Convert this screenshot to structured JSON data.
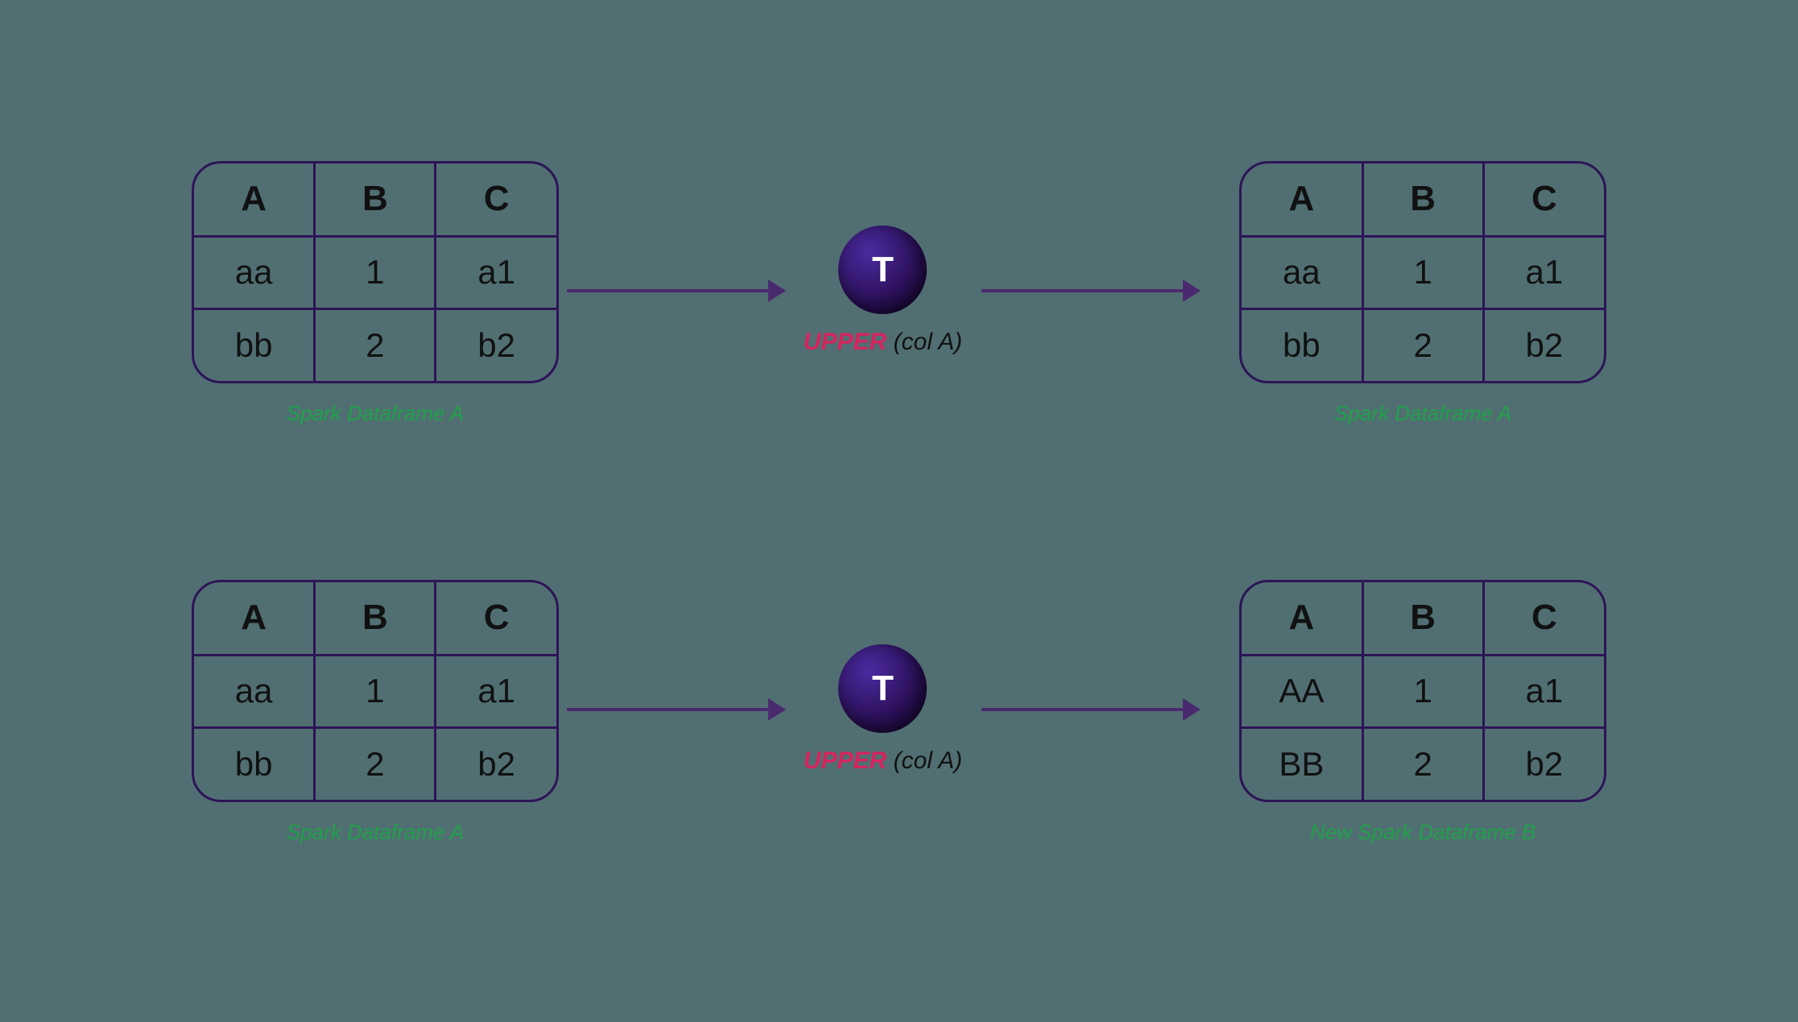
{
  "diagram": {
    "rows": [
      {
        "left_table": {
          "headers": [
            "A",
            "B",
            "C"
          ],
          "rows": [
            [
              "aa",
              "1",
              "a1"
            ],
            [
              "bb",
              "2",
              "b2"
            ]
          ],
          "caption": "Spark Dataframe A",
          "highlight_col_a": false
        },
        "transform": {
          "badge": "T",
          "label_hot": "UPPER",
          "label_rest": " (col A)"
        },
        "right_table": {
          "headers": [
            "A",
            "B",
            "C"
          ],
          "rows": [
            [
              "aa",
              "1",
              "a1"
            ],
            [
              "bb",
              "2",
              "b2"
            ]
          ],
          "caption": "Spark Dataframe A",
          "highlight_col_a": false
        }
      },
      {
        "left_table": {
          "headers": [
            "A",
            "B",
            "C"
          ],
          "rows": [
            [
              "aa",
              "1",
              "a1"
            ],
            [
              "bb",
              "2",
              "b2"
            ]
          ],
          "caption": "Spark Dataframe A",
          "highlight_col_a": false
        },
        "transform": {
          "badge": "T",
          "label_hot": "UPPER",
          "label_rest": " (col A)"
        },
        "right_table": {
          "headers": [
            "A",
            "B",
            "C"
          ],
          "rows": [
            [
              "AA",
              "1",
              "a1"
            ],
            [
              "BB",
              "2",
              "b2"
            ]
          ],
          "caption": "New Spark Dataframe B",
          "highlight_col_a": true
        }
      }
    ]
  },
  "colors": {
    "background": "#516f72",
    "border": "#2d1457",
    "hot": "#d6245f",
    "caption": "#1fa14a",
    "arrow": "#4a2a6e"
  }
}
